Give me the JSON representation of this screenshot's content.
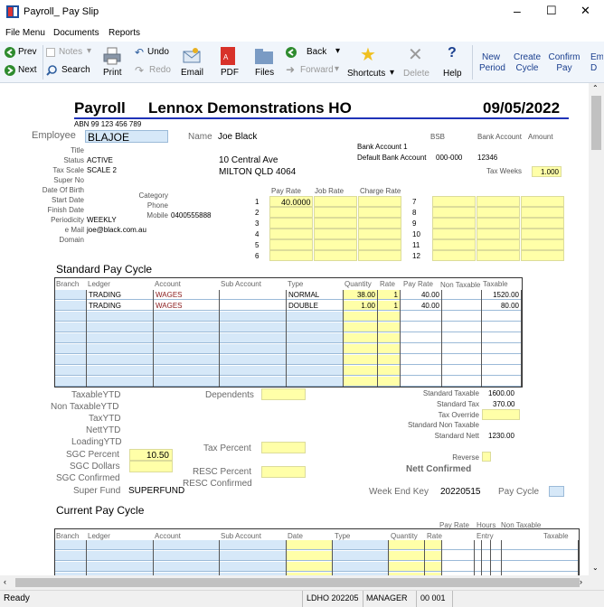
{
  "window": {
    "title": "Payroll_ Pay Slip",
    "minimize": "–",
    "maximize": "☐",
    "close": "✕"
  },
  "menu": [
    "File Menu",
    "Documents",
    "Reports"
  ],
  "toolbar": {
    "prev": "Prev",
    "next": "Next",
    "notes": "Notes",
    "search": "Search",
    "print": "Print",
    "undo": "Undo",
    "redo": "Redo",
    "email": "Email",
    "pdf": "PDF",
    "files": "Files",
    "back": "Back",
    "forward": "Forward",
    "shortcuts": "Shortcuts",
    "delete": "Delete",
    "help": "Help",
    "new_period": "New Period",
    "create_cycle": "Create Cycle",
    "confirm_pay": "Confirm Pay",
    "em": "Em D"
  },
  "header": {
    "payroll": "Payroll",
    "company": "Lennox Demonstrations HO",
    "date": "09/05/2022",
    "abn": "ABN 99 123 456 789"
  },
  "employee": {
    "label": "Employee",
    "code": "BLAJOE",
    "name_label": "Name",
    "name": "Joe Black",
    "title_label": "Title",
    "status_label": "Status",
    "status": "ACTIVE",
    "tax_scale_label": "Tax Scale",
    "tax_scale": "SCALE 2",
    "super_no_label": "Super No",
    "dob_label": "Date Of Birth",
    "start_label": "Start Date",
    "finish_label": "Finish Date",
    "periodicity_label": "Periodicity",
    "periodicity": "WEEKLY",
    "email_label": "e Mail",
    "email": "joe@black.com.au",
    "domain_label": "Domain",
    "category_label": "Category",
    "phone_label": "Phone",
    "mobile_label": "Mobile",
    "mobile": "0400555888",
    "address1": "10 Central Ave",
    "address2": "MILTON QLD 4064"
  },
  "bank": {
    "bsb_label": "BSB",
    "account_label": "Bank Account",
    "amount_label": "Amount",
    "bank_account_1_label": "Bank Account 1",
    "default_bank_label": "Default Bank Account",
    "default_bsb": "000-000",
    "default_account": "12346",
    "tax_weeks_label": "Tax Weeks",
    "tax_weeks": "1.000"
  },
  "rates": {
    "pay_rate_label": "Pay Rate",
    "job_rate_label": "Job Rate",
    "charge_rate_label": "Charge Rate",
    "left_rows": [
      "1",
      "2",
      "3",
      "4",
      "5",
      "6"
    ],
    "right_rows": [
      "7",
      "8",
      "9",
      "10",
      "11",
      "12"
    ],
    "pay_rate_1": "40.0000"
  },
  "standard": {
    "title": "Standard Pay Cycle",
    "non_taxable_label": "Non Taxable",
    "headers": [
      "Branch",
      "Ledger",
      "Account",
      "Sub Account",
      "Type",
      "Quantity",
      "Rate",
      "Pay Rate",
      "",
      "Taxable"
    ],
    "rows": [
      {
        "branch": "",
        "ledger": "TRADING",
        "account": "WAGES",
        "sub": "",
        "type": "NORMAL",
        "qty": "38.00",
        "rate": "1",
        "pay_rate": "40.00",
        "nontax": "",
        "taxable": "1520.00"
      },
      {
        "branch": "",
        "ledger": "TRADING",
        "account": "WAGES",
        "sub": "",
        "type": "DOUBLE",
        "qty": "1.00",
        "rate": "1",
        "pay_rate": "40.00",
        "nontax": "",
        "taxable": "80.00"
      }
    ]
  },
  "ytd": {
    "taxable": "TaxableYTD",
    "non_taxable": "Non TaxableYTD",
    "tax": "TaxYTD",
    "nett": "NettYTD",
    "loading": "LoadingYTD",
    "sgc_percent_label": "SGC Percent",
    "sgc_percent": "10.50",
    "sgc_dollars": "SGC Dollars",
    "sgc_confirmed": "SGC Confirmed",
    "super_fund_label": "Super Fund",
    "super_fund": "SUPERFUND",
    "dependents": "Dependents",
    "tax_percent": "Tax Percent",
    "resc_percent": "RESC Percent",
    "resc_confirmed": "RESC Confirmed"
  },
  "totals": {
    "standard_taxable_label": "Standard Taxable",
    "standard_taxable": "1600.00",
    "standard_tax_label": "Standard Tax",
    "standard_tax": "370.00",
    "tax_override_label": "Tax Override",
    "standard_non_taxable_label": "Standard Non Taxable",
    "standard_nett_label": "Standard Nett",
    "standard_nett": "1230.00",
    "reverse_label": "Reverse",
    "nett_confirmed": "Nett Confirmed",
    "week_end_key_label": "Week End Key",
    "week_end_key": "20220515",
    "pay_cycle_label": "Pay Cycle"
  },
  "current": {
    "title": "Current Pay Cycle",
    "top_headers": [
      "Pay Rate",
      "Hours",
      "Non Taxable"
    ],
    "headers": [
      "Branch",
      "Ledger",
      "Account",
      "Sub Account",
      "Date",
      "Type",
      "Quantity",
      "Rate",
      "Entry",
      "Taxable"
    ]
  },
  "status": {
    "ready": "Ready",
    "db": "LDHO 202205",
    "user": "MANAGER",
    "code": "00 001"
  }
}
